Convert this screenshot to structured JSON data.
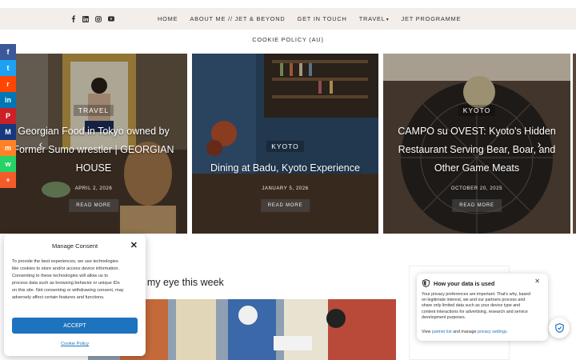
{
  "header": {
    "social": [
      "facebook-icon",
      "linkedin-icon",
      "instagram-icon",
      "youtube-icon"
    ],
    "nav": [
      {
        "label": "HOME"
      },
      {
        "label": "ABOUT ME // JET & BEYOND"
      },
      {
        "label": "GET IN TOUCH"
      },
      {
        "label": "TRAVEL",
        "caret": "▾"
      },
      {
        "label": "JET PROGRAMME"
      }
    ],
    "subnav": "COOKIE POLICY (AU)"
  },
  "slides": [
    {
      "category": "TRAVEL",
      "title": "Georgian Food in Tokyo owned by Former Sumo wrestler | GEORGIAN HOUSE",
      "date": "APRIL 2, 2026",
      "more": "READ MORE"
    },
    {
      "category": "KYOTO",
      "title": "Dining at Badu, Kyoto Experience",
      "date": "JANUARY 5, 2026",
      "more": "READ MORE"
    },
    {
      "category": "KYOTO",
      "title": "CAMPO su OVEST: Kyoto's Hidden Restaurant Serving Bear, Boar, and Other Game Meats",
      "date": "OCTOBER 20, 2025",
      "more": "READ MORE"
    }
  ],
  "slider_arrows": {
    "prev": "‹",
    "next": "›"
  },
  "share_buttons": [
    {
      "icon": "facebook-icon",
      "glyph": "f",
      "color": "#3b5998"
    },
    {
      "icon": "twitter-icon",
      "glyph": "t",
      "color": "#1da1f2"
    },
    {
      "icon": "reddit-icon",
      "glyph": "r",
      "color": "#ff4500"
    },
    {
      "icon": "linkedin-icon",
      "glyph": "in",
      "color": "#0077b5"
    },
    {
      "icon": "pinterest-icon",
      "glyph": "P",
      "color": "#cb2027"
    },
    {
      "icon": "mewe-icon",
      "glyph": "M",
      "color": "#17377f"
    },
    {
      "icon": "mix-icon",
      "glyph": "m",
      "color": "#ff8226"
    },
    {
      "icon": "whatsapp-icon",
      "glyph": "w",
      "color": "#25d366"
    },
    {
      "icon": "more-icon",
      "glyph": "+",
      "color": "#f65a29"
    }
  ],
  "consent": {
    "title": "Manage Consent",
    "close": "✕",
    "text": "To provide the best experiences, we use technologies like cookies to store and/or access device information. Consenting to these technologies will allow us to process data such as browsing behavior or unique IDs on this site. Not consenting or withdrawing consent, may adversely affect certain features and functions.",
    "accept": "ACCEPT",
    "policy": "Cookie Policy"
  },
  "section": {
    "heading": "nt my eye this week"
  },
  "privacy": {
    "title": "How your data is used",
    "close": "✕",
    "text": "Your privacy preferences are important. That's why, based on legitimate interest, we and our partners process and share only limited data such as your device type and content interactions for advertising, research and service development purposes.",
    "view": "View",
    "partner_list": "partner list",
    "and_manage": "and manage",
    "privacy_settings": "privacy settings."
  },
  "colors": {
    "accent": "#1e73be",
    "topbar": "#f4eeea"
  }
}
